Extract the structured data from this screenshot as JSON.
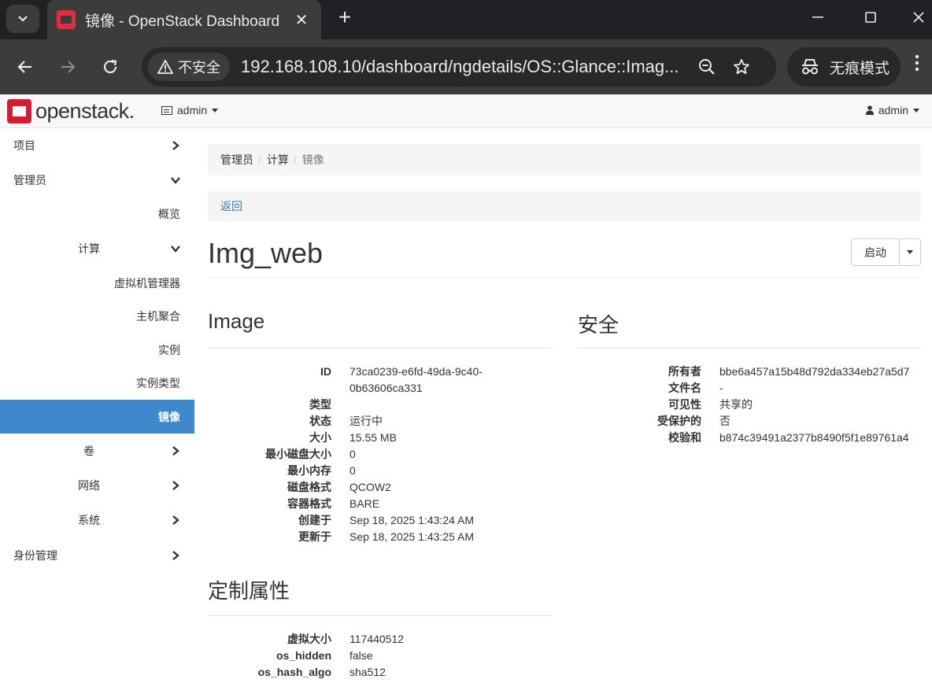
{
  "browser": {
    "tab_title": "镜像 - OpenStack Dashboard",
    "insecure_label": "不安全",
    "url": "192.168.108.10/dashboard/ngdetails/OS::Glance::Imag...",
    "incognito_label": "无痕模式"
  },
  "navbar": {
    "logo_text": "openstack.",
    "project": "admin",
    "user": "admin"
  },
  "sidebar": {
    "items": [
      {
        "label": "项目"
      },
      {
        "label": "管理员"
      },
      {
        "label": "概览"
      },
      {
        "label": "计算"
      },
      {
        "label": "虚拟机管理器"
      },
      {
        "label": "主机聚合"
      },
      {
        "label": "实例"
      },
      {
        "label": "实例类型"
      },
      {
        "label": "镜像"
      },
      {
        "label": "卷"
      },
      {
        "label": "网络"
      },
      {
        "label": "系统"
      },
      {
        "label": "身份管理"
      }
    ]
  },
  "breadcrumb": [
    "管理员",
    "计算",
    "镜像"
  ],
  "back_label": "返回",
  "page_title": "Img_web",
  "launch_label": "启动",
  "image_section": {
    "title": "Image",
    "fields": [
      {
        "k": "ID",
        "v": "73ca0239-e6fd-49da-9c40-"
      },
      {
        "k": "",
        "v": "0b63606ca331"
      },
      {
        "k": "类型",
        "v": ""
      },
      {
        "k": "状态",
        "v": "运行中"
      },
      {
        "k": "大小",
        "v": "15.55 MB"
      },
      {
        "k": "最小磁盘大小",
        "v": "0"
      },
      {
        "k": "最小内存",
        "v": "0"
      },
      {
        "k": "磁盘格式",
        "v": "QCOW2"
      },
      {
        "k": "容器格式",
        "v": "BARE"
      },
      {
        "k": "创建于",
        "v": "Sep 18, 2025 1:43:24 AM"
      },
      {
        "k": "更新于",
        "v": "Sep 18, 2025 1:43:25 AM"
      }
    ]
  },
  "security_section": {
    "title": "安全",
    "fields": [
      {
        "k": "所有者",
        "v": "bbe6a457a15b48d792da334eb27a5d7"
      },
      {
        "k": "文件名",
        "v": "-"
      },
      {
        "k": "可见性",
        "v": "共享的"
      },
      {
        "k": "受保护的",
        "v": "否"
      },
      {
        "k": "校验和",
        "v": "b874c39491a2377b8490f5f1e89761a4"
      }
    ]
  },
  "custom_section": {
    "title": "定制属性",
    "fields": [
      {
        "k": "虚拟大小",
        "v": "117440512"
      },
      {
        "k": "os_hidden",
        "v": "false"
      },
      {
        "k": "os_hash_algo",
        "v": "sha512"
      }
    ]
  }
}
